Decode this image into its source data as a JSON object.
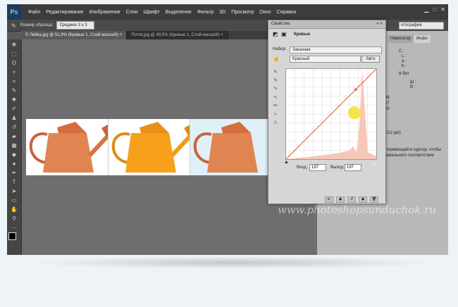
{
  "menubar": {
    "logo": "Ps",
    "items": [
      "Файл",
      "Редактирование",
      "Изображение",
      "Слои",
      "Шрифт",
      "Выделение",
      "Фильтр",
      "3D",
      "Просмотр",
      "Окно",
      "Справка"
    ]
  },
  "window_controls": [
    "▁",
    "□",
    "✕"
  ],
  "options_bar": {
    "label": "Размер образца:",
    "value": "Среднее 3 х 3",
    "right_select": "отография"
  },
  "tabs": [
    {
      "label": "© Лейка.jpg @ 51,9% (Кривые 1, Слой-маска/8) ×"
    },
    {
      "label": "Поток.jpg @ 49,5% (Кривые 1, Слой-маска/8) ×"
    }
  ],
  "right_panel": {
    "tabs": [
      "Навигатор",
      "Инфо"
    ],
    "info": {
      "line1": "C :",
      "line2": "L :",
      "line3": "a :",
      "line4": "b :",
      "bits": "8-бит",
      "w": "Ш :",
      "h": "В :",
      "v1": "86",
      "v2": "07",
      "v3": "00",
      "ppi": "5,012 ppi)",
      "hint1": "и перемещайте курсор, чтобы",
      "hint2": "птимального соответствие"
    }
  },
  "properties": {
    "title": "Свойства",
    "close": "«  ×",
    "header": "Кривые",
    "preset_label": "Набор:",
    "preset_value": "Заказная",
    "channel_value": "Красный",
    "auto_button": "Авто",
    "input_label": "Вход:",
    "input_value": "197",
    "output_label": "Выход:",
    "output_value": "197"
  },
  "curve_data": {
    "control_point": {
      "input": 197,
      "output": 197
    },
    "channel_color": "#e8562f"
  },
  "watermark": "www.photoshopsunduchok.ru"
}
